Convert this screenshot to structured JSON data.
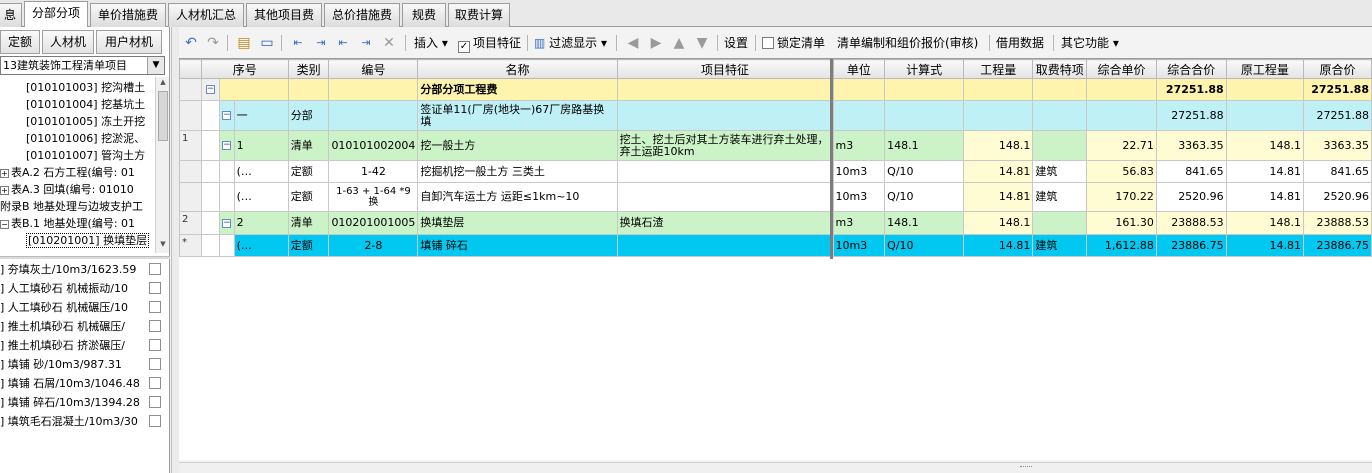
{
  "tabs": [
    "息",
    "分部分项",
    "单价措施费",
    "人材机汇总",
    "其他项目费",
    "总价措施费",
    "规费",
    "取费计算"
  ],
  "left": {
    "subtabs": [
      "定额",
      "人材机",
      "用户材机"
    ],
    "combo_value": "13建筑装饰工程清单项目",
    "tree": [
      "[010101003] 挖沟槽土",
      "[010101004] 挖基坑土",
      "[010101005] 冻土开挖",
      "[010101006] 挖淤泥、",
      "[010101007] 管沟土方",
      "表A.2 石方工程(编号: 01",
      "表A.3 回填(编号: 01010",
      "附录B 地基处理与边坡支护工",
      "表B.1 地基处理(编号: 01",
      "[010201001] 换填垫层"
    ],
    "resources": [
      "] 夯填灰土/10m3/1623.59",
      "] 人工填砂石 机械振动/10",
      "] 人工填砂石 机械碾压/10",
      "] 推土机填砂石 机械碾压/",
      "] 推土机填砂石 挤淤碾压/",
      "] 填铺 砂/10m3/987.31",
      "] 填铺 石屑/10m3/1046.48",
      "] 填铺 碎石/10m3/1394.28",
      "] 填筑毛石混凝土/10m3/30"
    ]
  },
  "toolbar": {
    "insert": "插入",
    "feature": "项目特征",
    "filter": "过滤显示",
    "settings": "设置",
    "lock": "锁定清单",
    "compile": "清单编制和组价报价(审核)",
    "borrow": "借用数据",
    "other": "其它功能"
  },
  "grid": {
    "headers": [
      "序号",
      "类别",
      "编号",
      "名称",
      "项目特征",
      "单位",
      "计算式",
      "工程量",
      "取费特项",
      "综合单价",
      "综合合价",
      "原工程量",
      "原合价"
    ],
    "rows": [
      {
        "rn": "",
        "seq": "",
        "type": "",
        "code": "",
        "name": "分部分项工程费",
        "feature": "",
        "unit": "",
        "formula": "",
        "qty": "",
        "fee": "",
        "price": "",
        "total": "27251.88",
        "oqty": "",
        "ototal": "27251.88"
      },
      {
        "rn": "",
        "seq": "一",
        "type": "分部",
        "code": "",
        "name": "签证单11(厂房(地块一)67厂房路基换填",
        "feature": "",
        "unit": "",
        "formula": "",
        "qty": "",
        "fee": "",
        "price": "",
        "total": "27251.88",
        "oqty": "",
        "ototal": "27251.88"
      },
      {
        "rn": "1",
        "seq": "1",
        "type": "清单",
        "code": "010101002004",
        "name": "挖一般土方",
        "feature": "挖土、挖土后对其土方装车进行弃土处理，弃土运距10km",
        "unit": "m3",
        "formula": "148.1",
        "qty": "148.1",
        "fee": "",
        "price": "22.71",
        "total": "3363.35",
        "oqty": "148.1",
        "ototal": "3363.35"
      },
      {
        "rn": "",
        "seq": "(…",
        "type": "定额",
        "code": "1-42",
        "name": "挖掘机挖一般土方 三类土",
        "feature": "",
        "unit": "10m3",
        "formula": "Q/10",
        "qty": "14.81",
        "fee": "建筑",
        "price": "56.83",
        "total": "841.65",
        "oqty": "14.81",
        "ototal": "841.65"
      },
      {
        "rn": "",
        "seq": "(…",
        "type": "定额",
        "code": "1-63 + 1-64 *9换",
        "name": "自卸汽车运土方 运距≤1km~10",
        "feature": "",
        "unit": "10m3",
        "formula": "Q/10",
        "qty": "14.81",
        "fee": "建筑",
        "price": "170.22",
        "total": "2520.96",
        "oqty": "14.81",
        "ototal": "2520.96"
      },
      {
        "rn": "2",
        "seq": "2",
        "type": "清单",
        "code": "010201001005",
        "name": "换填垫层",
        "feature": "换填石渣",
        "unit": "m3",
        "formula": "148.1",
        "qty": "148.1",
        "fee": "",
        "price": "161.30",
        "total": "23888.53",
        "oqty": "148.1",
        "ototal": "23888.53"
      },
      {
        "rn": "*",
        "seq": "(…",
        "type": "定额",
        "code": "2-8",
        "name": "填铺 碎石",
        "feature": "",
        "unit": "10m3",
        "formula": "Q/10",
        "qty": "14.81",
        "fee": "建筑",
        "price": "1,612.88",
        "total": "23886.75",
        "oqty": "14.81",
        "ototal": "23886.75"
      }
    ]
  }
}
